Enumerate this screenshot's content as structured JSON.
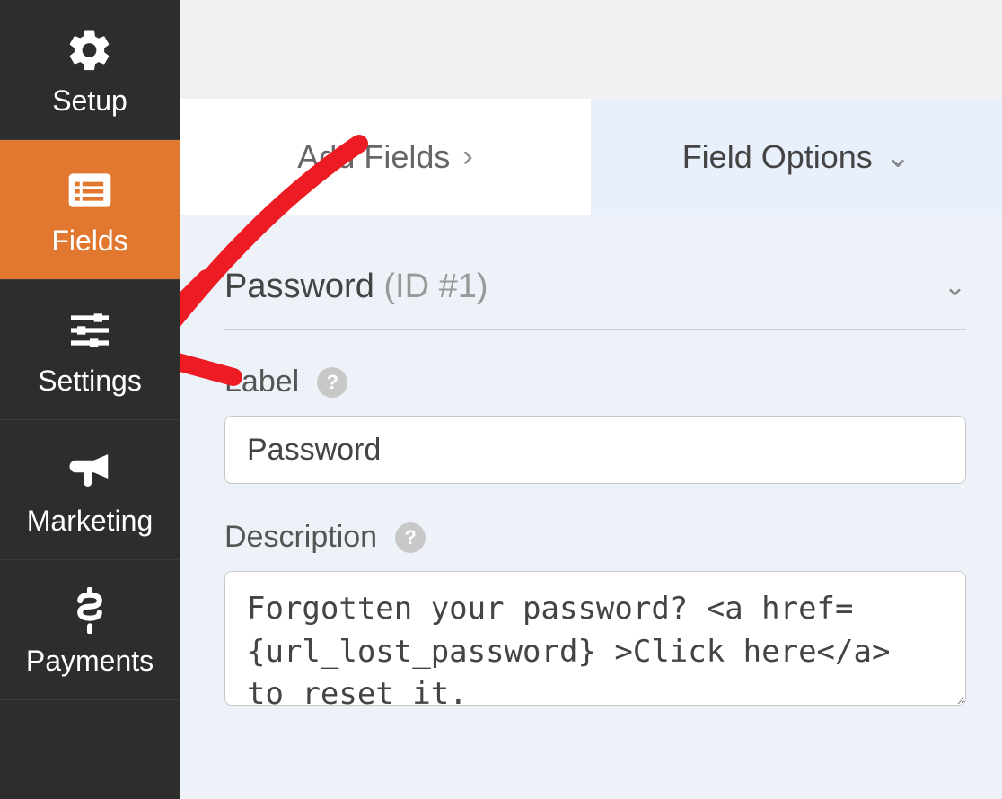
{
  "sidebar": {
    "items": [
      {
        "label": "Setup",
        "icon": "gear-icon",
        "active": false
      },
      {
        "label": "Fields",
        "icon": "list-icon",
        "active": true
      },
      {
        "label": "Settings",
        "icon": "sliders-icon",
        "active": false
      },
      {
        "label": "Marketing",
        "icon": "bullhorn-icon",
        "active": false
      },
      {
        "label": "Payments",
        "icon": "dollar-icon",
        "active": false
      }
    ]
  },
  "tabs": {
    "add_fields": "Add Fields",
    "field_options": "Field Options"
  },
  "field": {
    "name": "Password",
    "id_label": "(ID #1)",
    "label_heading": "Label",
    "label_value": "Password",
    "description_heading": "Description",
    "description_value": "Forgotten your password? <a href={url_lost_password} >Click here</a> to reset it."
  },
  "annotation": {
    "type": "arrow",
    "color": "#ed1c24",
    "points_to": "sidebar-item-settings"
  }
}
